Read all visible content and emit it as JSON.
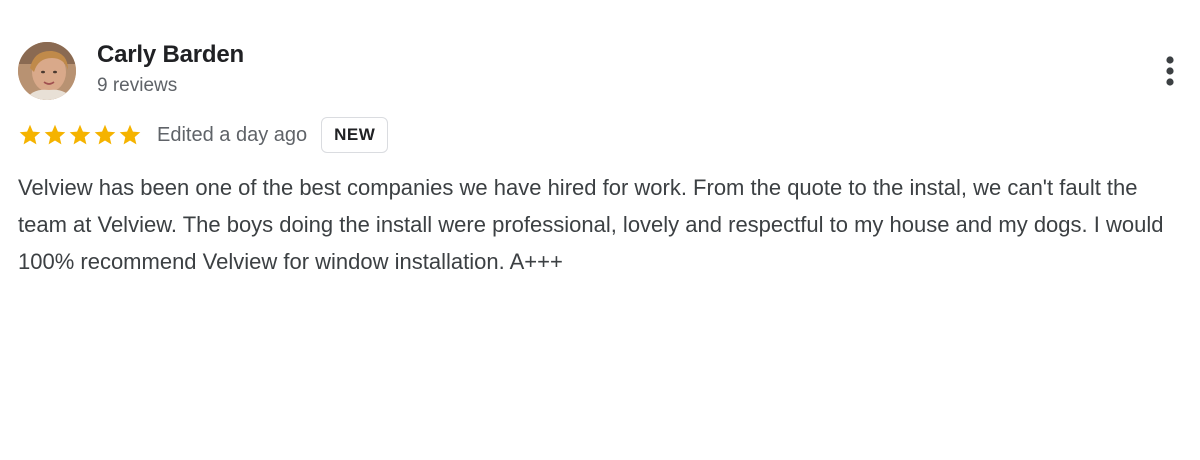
{
  "review": {
    "author": {
      "name": "Carly Barden",
      "review_count": "9 reviews",
      "avatar_icon": "user-avatar-photo"
    },
    "rating": 5,
    "rating_max": 5,
    "star_color": "#f5b300",
    "edited_label": "Edited a day ago",
    "badge_label": "NEW",
    "text": "Velview has been one of the best companies we have hired for work. From the quote to the instal, we can't fault the team at Velview. The boys doing the install were professional, lovely and respectful to my house and my dogs. I would 100% recommend Velview for window installation. A+++"
  },
  "menu": {
    "icon": "more-vert-icon"
  }
}
